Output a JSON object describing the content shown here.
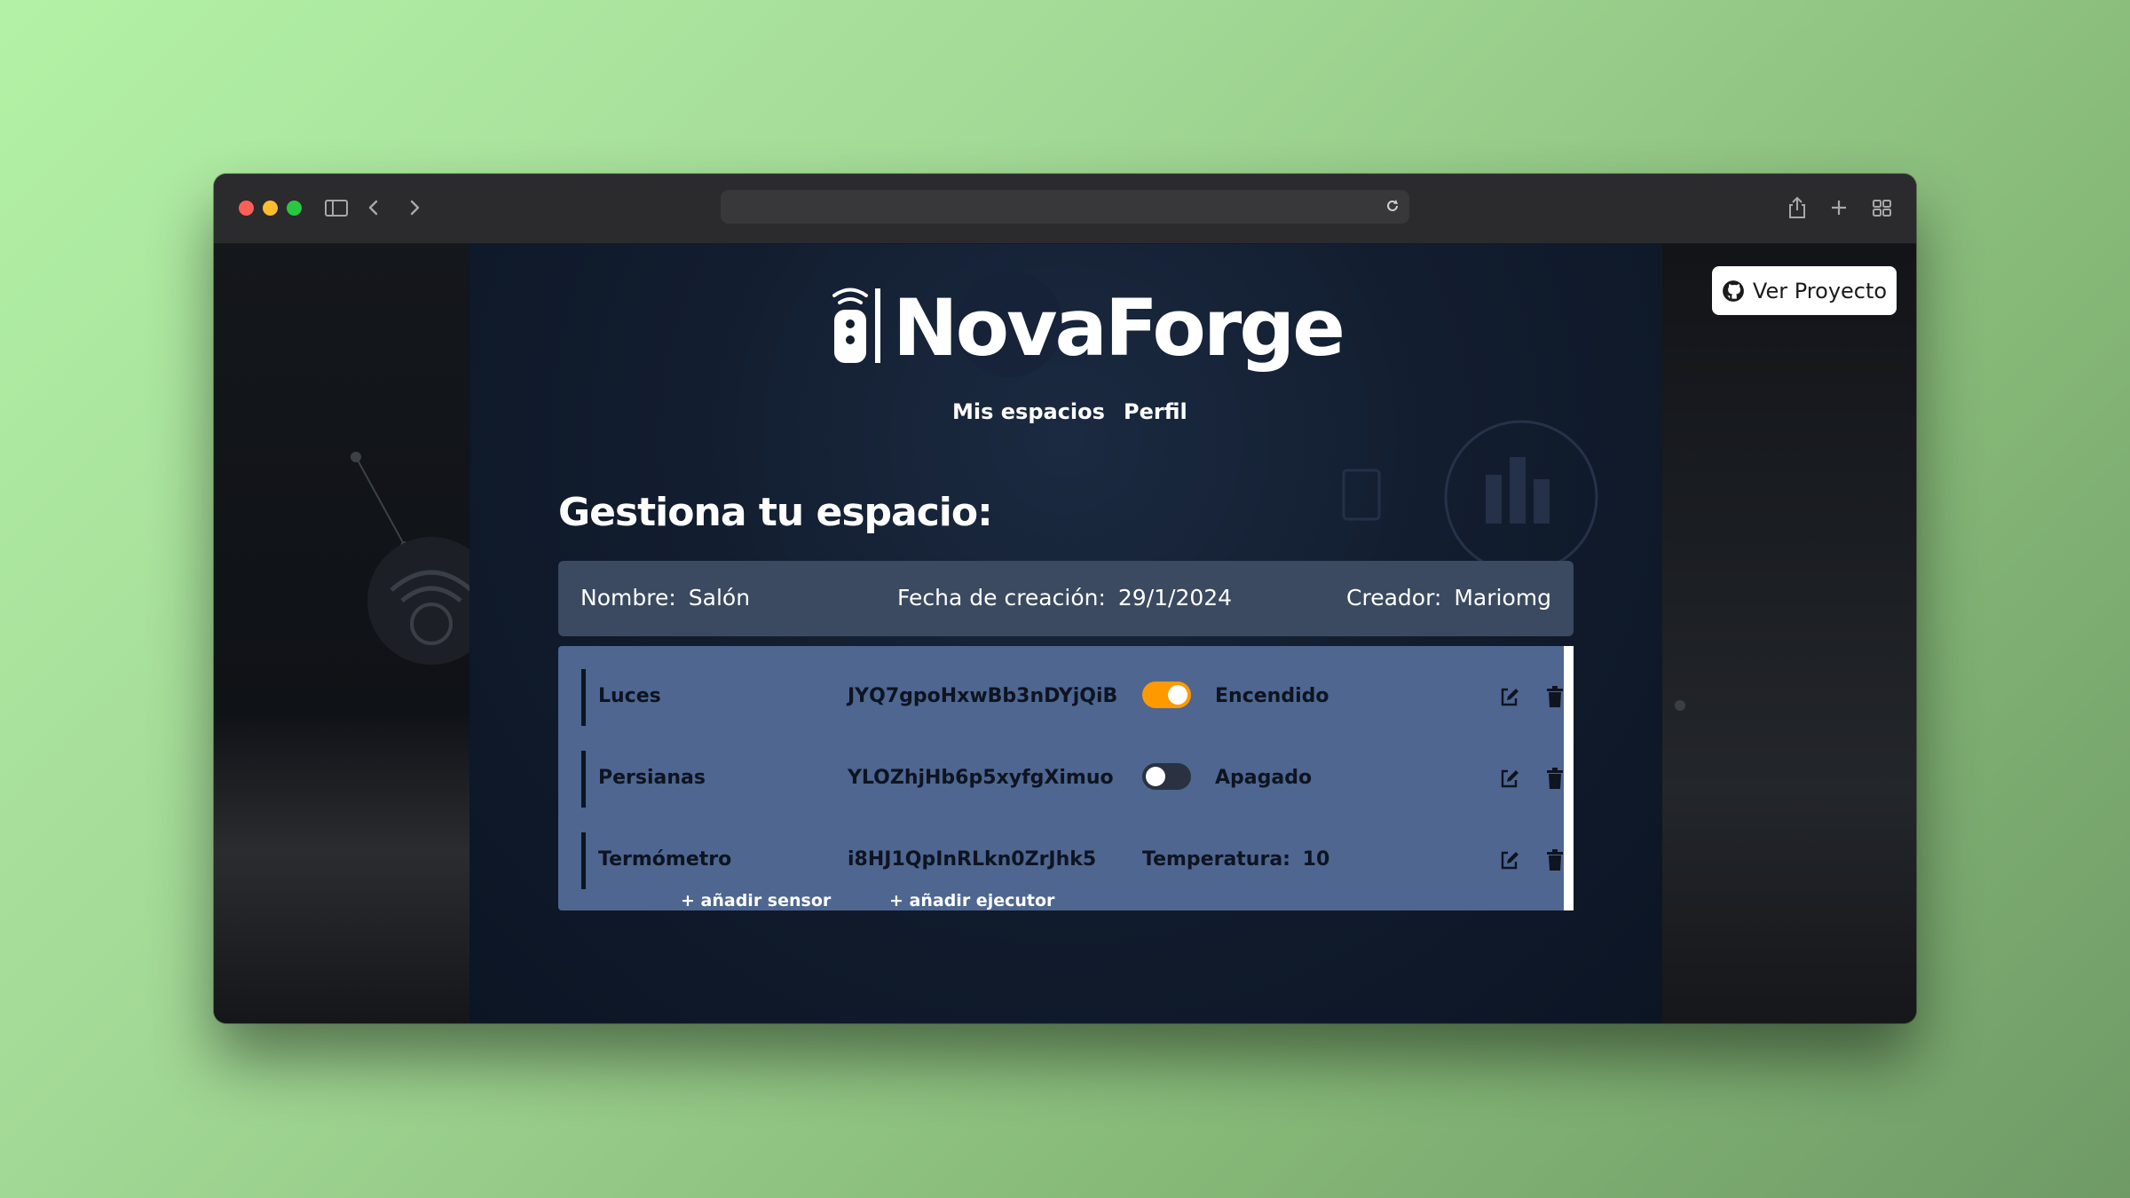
{
  "browser": {
    "address": ""
  },
  "site": {
    "brand": "NovaForge",
    "nav": [
      "Mis espacios",
      "Perfil"
    ],
    "github_button": "Ver Proyecto"
  },
  "page": {
    "title": "Gestiona tu espacio:",
    "info": {
      "name_label": "Nombre:",
      "name_value": "Salón",
      "date_label": "Fecha de creación:",
      "date_value": "29/1/2024",
      "creator_label": "Creador:",
      "creator_value": "Mariomg"
    },
    "devices": [
      {
        "name": "Luces",
        "id": "JYQ7gpoHxwBb3nDYjQiB",
        "type": "executor",
        "state_on": true,
        "status": "Encendido"
      },
      {
        "name": "Persianas",
        "id": "YLOZhjHb6p5xyfgXimuo",
        "type": "executor",
        "state_on": false,
        "status": "Apagado"
      },
      {
        "name": "Termómetro",
        "id": "i8HJ1QpInRLkn0ZrJhk5",
        "type": "sensor",
        "reading_label": "Temperatura:",
        "reading_value": "10"
      }
    ],
    "add_sensor": "+ añadir sensor",
    "add_executor": "+ añadir ejecutor"
  },
  "colors": {
    "toggle_on": "#ff9900",
    "device_panel": "#4e6690",
    "info_bar": "#3b4a60"
  }
}
